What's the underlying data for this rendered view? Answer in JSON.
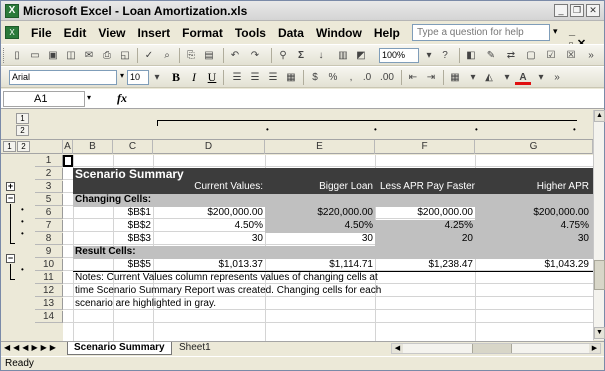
{
  "window": {
    "app_icon": "excel-icon",
    "title": "Microsoft Excel - Loan Amortization.xls"
  },
  "menu": {
    "items": [
      {
        "label": "File"
      },
      {
        "label": "Edit"
      },
      {
        "label": "View"
      },
      {
        "label": "Insert"
      },
      {
        "label": "Format"
      },
      {
        "label": "Tools"
      },
      {
        "label": "Data"
      },
      {
        "label": "Window"
      },
      {
        "label": "Help"
      }
    ],
    "help_placeholder": "Type a question for help"
  },
  "toolbar": {
    "zoom": "100%",
    "font_name": "Arial",
    "font_size": "10"
  },
  "formula_bar": {
    "name_box": "A1",
    "fx_label": "fx"
  },
  "outline": {
    "row_levels": [
      "1",
      "2"
    ],
    "col_levels": [
      "1",
      "2"
    ]
  },
  "columns": [
    "A",
    "B",
    "C",
    "D",
    "E",
    "F",
    "G"
  ],
  "rows": [
    "1",
    "2",
    "3",
    "5",
    "6",
    "7",
    "8",
    "9",
    "10",
    "11",
    "12",
    "13",
    "14"
  ],
  "sheet": {
    "title": "Scenario Summary",
    "headers": [
      "Current Values:",
      "Bigger Loan",
      "Less APR Pay Faster",
      "Higher APR"
    ],
    "changing_label": "Changing Cells:",
    "changing": [
      {
        "ref": "$B$1",
        "values": [
          "$200,000.00",
          "$220,000.00",
          "$200,000.00",
          "$200,000.00"
        ]
      },
      {
        "ref": "$B$2",
        "values": [
          "4.50%",
          "4.50%",
          "4.25%",
          "4.75%"
        ]
      },
      {
        "ref": "$B$3",
        "values": [
          "30",
          "30",
          "20",
          "30"
        ]
      }
    ],
    "result_label": "Result Cells:",
    "results": [
      {
        "ref": "$B$5",
        "values": [
          "$1,013.37",
          "$1,114.71",
          "$1,238.47",
          "$1,043.29"
        ]
      }
    ],
    "notes": [
      "Notes:  Current Values column represents values of changing cells at",
      "time Scenario Summary Report was created.  Changing cells for each",
      "scenario are highlighted in gray."
    ]
  },
  "tabs": {
    "active": "Scenario Summary",
    "other": "Sheet1"
  },
  "status": {
    "text": "Ready"
  }
}
